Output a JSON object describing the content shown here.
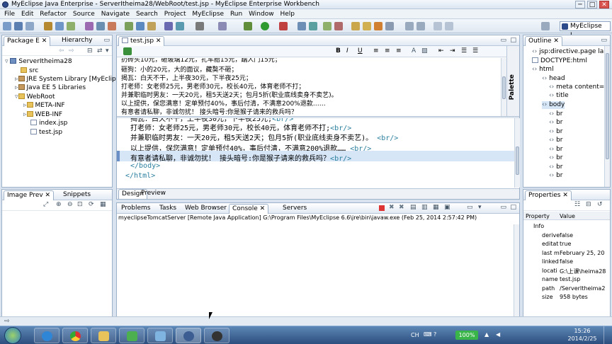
{
  "window": {
    "title": "MyEclipse Java Enterprise - ServerItheima28/WebRoot/test.jsp - MyEclipse Enterprise Workbench",
    "minimize": "─",
    "maximize": "□",
    "close": "✕"
  },
  "menu": [
    "File",
    "Edit",
    "Refactor",
    "Source",
    "Navigate",
    "Search",
    "Project",
    "MyEclipse",
    "Run",
    "Window",
    "Help"
  ],
  "perspective": "MyEclipse J...",
  "package_explorer": {
    "tabs": [
      "Package E",
      "Hierarchy"
    ],
    "items": [
      {
        "label": "ServerItheima28",
        "icon": "project-icon"
      },
      {
        "label": "src",
        "icon": "source-folder-icon"
      },
      {
        "label": "JRE System Library [MyEclipse",
        "icon": "library-icon"
      },
      {
        "label": "Java EE 5 Libraries",
        "icon": "library-icon"
      },
      {
        "label": "WebRoot",
        "icon": "folder-icon"
      },
      {
        "label": "META-INF",
        "icon": "folder-icon"
      },
      {
        "label": "WEB-INF",
        "icon": "folder-icon"
      },
      {
        "label": "index.jsp",
        "icon": "jsp-file-icon"
      },
      {
        "label": "test.jsp",
        "icon": "jsp-file-icon"
      }
    ]
  },
  "image_preview": {
    "tabs": [
      "Image Prev",
      "Snippets"
    ]
  },
  "editor": {
    "tab": "test.jsp",
    "palette": "Palette",
    "preview_lines": [
      "扔砖头10元，砸玻璃12元，扎车胎15元，踹人门15元；",
      "砸狗：小的20元，大的面议，藏獒不砸；",
      "揭瓦：白天不干，上半夜30元，下半夜25元；",
      "打老师：女老师25元，男老师30元，校长40元，体育老师不打；",
      "并兼职临时男友：一天20元，租5天送2天；包月5折(职业底线卖身不卖艺)。",
      "以上提供，保您满意！定单预付40%，事后付清，不满意200%退款……",
      "有意者请私聊，非诚勿扰！  接头暗号:你是猴子请来的救兵吗？"
    ],
    "source_lines": [
      {
        "text": "打老师：女老师25元，男老师30元，校长40元，体育老师不打;",
        "tag": "<br/>"
      },
      {
        "text": "并兼职临时男友：一天20元，租5天送2天；包月5折(职业底线卖身不卖艺)。",
        "tag": "<br/>"
      },
      {
        "text": "以上提供，保您满意！定单预付40%，事后付清，不满意200%退款……",
        "tag": "<br/>"
      },
      {
        "text": "有意者请私聊，非诚勿扰！  接头暗号:你是猴子请来的救兵吗？",
        "tag": "<br/>"
      },
      {
        "text": "",
        "tag": "</body>"
      },
      {
        "text": "",
        "tag": "</html>"
      }
    ],
    "bottom_tabs": [
      "Design",
      "Preview"
    ]
  },
  "outline": {
    "tab": "Outline",
    "items": [
      "jsp:directive.page langu",
      "DOCTYPE:html",
      "html",
      "head",
      "meta content=te",
      "title",
      "body",
      "br",
      "br",
      "br",
      "br",
      "br",
      "br",
      "br",
      "br"
    ]
  },
  "console": {
    "tabs": [
      "Problems",
      "Tasks",
      "Web Browser",
      "Console",
      "Servers"
    ],
    "line": "myeclipseTomcatServer [Remote Java Application] G:\\Program Files\\MyEclipse 6.6\\jre\\bin\\javaw.exe (Feb 25, 2014 2:57:42 PM)"
  },
  "properties": {
    "tab": "Properties",
    "header": {
      "property": "Property",
      "value": "Value"
    },
    "section": "Info",
    "rows": [
      {
        "k": "derive",
        "v": "false"
      },
      {
        "k": "editat",
        "v": "true"
      },
      {
        "k": "last m",
        "v": "February 25, 20"
      },
      {
        "k": "linked",
        "v": "false"
      },
      {
        "k": "locati",
        "v": "G:\\上课\\heima28"
      },
      {
        "k": "name",
        "v": "test.jsp"
      },
      {
        "k": "path",
        "v": "/ServerItheima2"
      },
      {
        "k": "size",
        "v": "958  bytes"
      }
    ]
  },
  "taskbar": {
    "battery": "100%",
    "lang": "CH",
    "time": "15:26",
    "date": "2014/2/25"
  },
  "colors": {
    "tag": "#2a7f9e",
    "taskbar": "#2c4e7e",
    "highlight": "#d6e6f7"
  }
}
